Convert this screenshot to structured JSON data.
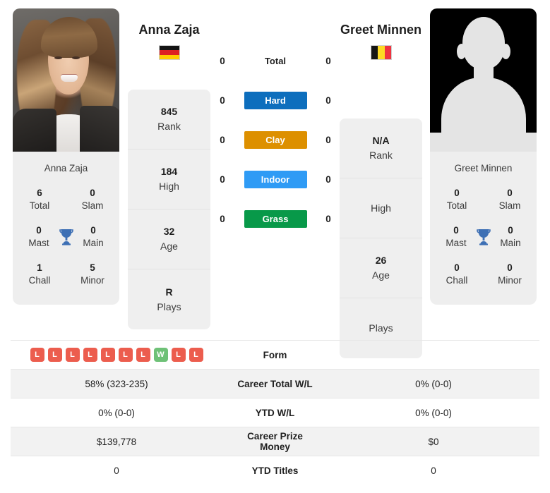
{
  "players": {
    "left": {
      "name": "Anna Zaja",
      "flag": "de",
      "flag_name": "germany-flag",
      "photo_name": "anna-zaja-photo",
      "rank": "845",
      "rank_label": "Rank",
      "high": "184",
      "high_label": "High",
      "age": "32",
      "age_label": "Age",
      "plays": "R",
      "plays_label": "Plays",
      "titles": [
        {
          "value": "6",
          "label": "Total"
        },
        {
          "value": "0",
          "label": "Slam"
        },
        {
          "value": "0",
          "label": "Mast"
        },
        {
          "value": "0",
          "label": "Main"
        },
        {
          "value": "1",
          "label": "Chall"
        },
        {
          "value": "5",
          "label": "Minor"
        }
      ]
    },
    "right": {
      "name": "Greet Minnen",
      "flag": "be",
      "flag_name": "belgium-flag",
      "photo_name": "greet-minnen-photo",
      "rank": "N/A",
      "rank_label": "Rank",
      "high": "",
      "high_label": "High",
      "age": "26",
      "age_label": "Age",
      "plays": "",
      "plays_label": "Plays",
      "titles": [
        {
          "value": "0",
          "label": "Total"
        },
        {
          "value": "0",
          "label": "Slam"
        },
        {
          "value": "0",
          "label": "Mast"
        },
        {
          "value": "0",
          "label": "Main"
        },
        {
          "value": "0",
          "label": "Chall"
        },
        {
          "value": "0",
          "label": "Minor"
        }
      ]
    }
  },
  "surfaces": [
    {
      "label": "Total",
      "left": "0",
      "right": "0",
      "color": "transparent",
      "text_color": "#1f1f1f"
    },
    {
      "label": "Hard",
      "left": "0",
      "right": "0",
      "color": "#0d6ebd",
      "text_color": "#ffffff"
    },
    {
      "label": "Clay",
      "left": "0",
      "right": "0",
      "color": "#dd9000",
      "text_color": "#ffffff"
    },
    {
      "label": "Indoor",
      "left": "0",
      "right": "0",
      "color": "#2f9bf5",
      "text_color": "#ffffff"
    },
    {
      "label": "Grass",
      "left": "0",
      "right": "0",
      "color": "#089949",
      "text_color": "#ffffff"
    }
  ],
  "table": {
    "form": {
      "label": "Form",
      "left_results": [
        "L",
        "L",
        "L",
        "L",
        "L",
        "L",
        "L",
        "W",
        "L",
        "L"
      ],
      "right_results": [],
      "win_color": "#6ec177",
      "loss_color": "#ec5d4e"
    },
    "rows": [
      {
        "label": "Career Total W/L",
        "left": "58% (323-235)",
        "right": "0% (0-0)"
      },
      {
        "label": "YTD W/L",
        "left": "0% (0-0)",
        "right": "0% (0-0)"
      },
      {
        "label": "Career Prize Money",
        "left": "$139,778",
        "right": "$0"
      },
      {
        "label": "YTD Titles",
        "left": "0",
        "right": "0"
      }
    ]
  }
}
